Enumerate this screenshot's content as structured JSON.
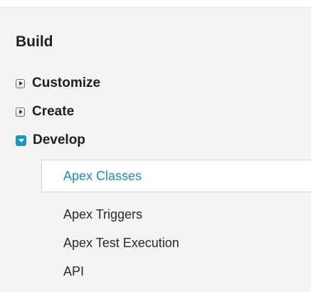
{
  "section": {
    "title": "Build"
  },
  "nav": {
    "items": [
      {
        "label": "Customize",
        "expanded": false
      },
      {
        "label": "Create",
        "expanded": false
      },
      {
        "label": "Develop",
        "expanded": true
      }
    ],
    "develop_children": [
      {
        "label": "Apex Classes",
        "selected": true
      },
      {
        "label": "Apex Triggers",
        "selected": false
      },
      {
        "label": "Apex Test Execution",
        "selected": false
      },
      {
        "label": "API",
        "selected": false
      }
    ]
  },
  "colors": {
    "accent": "#1797c0",
    "selected_text": "#1b8ec2",
    "background": "#f4f4f4"
  },
  "icons": {
    "collapsed": "triangle-right-icon",
    "expanded": "triangle-down-icon"
  }
}
